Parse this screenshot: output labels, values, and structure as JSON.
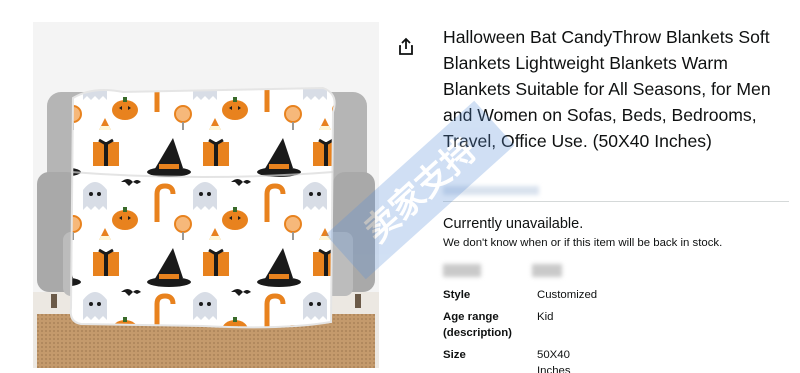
{
  "product": {
    "title": "Halloween Bat CandyThrow Blankets Soft Blankets Lightweight Blankets Warm Blankets Suitable for All Seasons, for Men and Women on Sofas, Beds, Bedrooms, Travel, Office Use. (50X40 Inches)",
    "image_alt": "Halloween bat candy throw blanket on a grey sofa"
  },
  "availability": {
    "status": "Currently unavailable.",
    "note": "We don't know when or if this item will be back in stock."
  },
  "specs": [
    {
      "key": "Style",
      "value": "Customized"
    },
    {
      "key": "Age range (description)",
      "value": "Kid"
    },
    {
      "key": "Size",
      "value": "50X40 Inches"
    }
  ],
  "watermark_text": "卖家支持",
  "icons": {
    "share": "share-icon"
  },
  "colors": {
    "orange": "#e8821e",
    "black": "#1a1a1a",
    "sofa": "#b9b9b9",
    "rug": "#c9a37a"
  }
}
